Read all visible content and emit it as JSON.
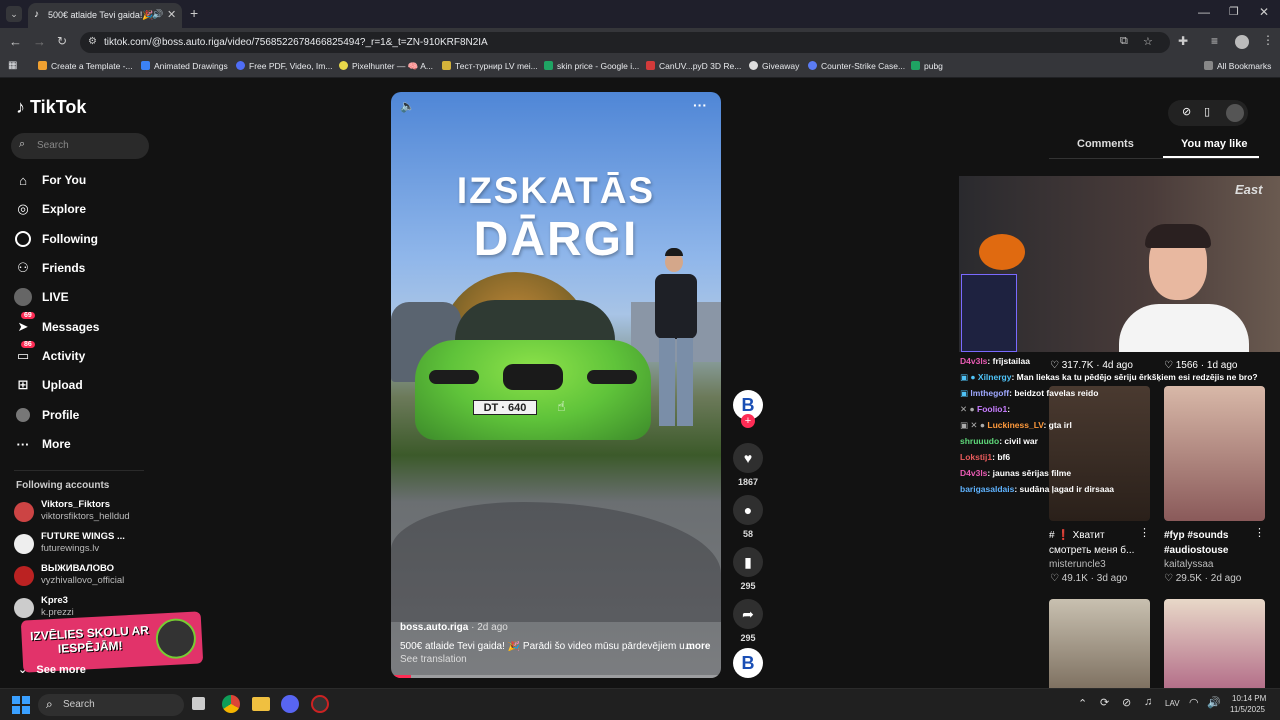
{
  "browser": {
    "tab_title": "500€ atlaide Tevi gaida!🎉",
    "url": "tiktok.com/@boss.auto.riga/video/7568522678466825494?_r=1&_t=ZN-910KRF8N2IA",
    "bookmarks": [
      "Create a Template -...",
      "Animated Drawings",
      "Free PDF, Video, Im...",
      "Pixelhunter — 🧠 A...",
      "Тест-турнир LV mei...",
      "skin price - Google i...",
      "CanUV...pyD 3D Re...",
      "Giveaway",
      "Counter-Strike Case...",
      "pubg"
    ],
    "all_bookmarks": "All Bookmarks"
  },
  "sidebar": {
    "logo": "TikTok",
    "search_placeholder": "Search",
    "nav": [
      {
        "label": "For You",
        "icon": "home-icon"
      },
      {
        "label": "Explore",
        "icon": "compass-icon"
      },
      {
        "label": "Following",
        "icon": "following-icon"
      },
      {
        "label": "Friends",
        "icon": "friends-icon"
      },
      {
        "label": "LIVE",
        "icon": "live-icon"
      },
      {
        "label": "Messages",
        "icon": "messages-icon",
        "badge": "69"
      },
      {
        "label": "Activity",
        "icon": "activity-icon",
        "badge": "86"
      },
      {
        "label": "Upload",
        "icon": "upload-icon"
      },
      {
        "label": "Profile",
        "icon": "profile-icon"
      },
      {
        "label": "More",
        "icon": "more-icon"
      }
    ],
    "following_title": "Following accounts",
    "accounts": [
      {
        "name": "Viktors_Fiktors",
        "handle": "viktorsfiktors_helldud"
      },
      {
        "name": "FUTURE WINGS ...",
        "handle": "futurewings.lv"
      },
      {
        "name": "ВЫЖИВАЛОВО",
        "handle": "vyzhivallovo_official"
      },
      {
        "name": "Kpre3",
        "handle": "k.prezzi"
      }
    ],
    "see_more": "See more",
    "ad_text": "IZVĒLIES SKOLU AR IESPĒJĀM!"
  },
  "video": {
    "title_line1": "IZSKATĀS",
    "title_line2": "DĀRGI",
    "plate": "DT · 640",
    "author": "boss.auto.riga",
    "date": "· 2d ago",
    "caption": "500€ atlaide Tevi gaida! 🎉   Parādi šo video mūsu pārdevējiem u...",
    "more": "more",
    "see_translation": "See translation"
  },
  "actions": {
    "likes": "1867",
    "comments": "58",
    "saves": "295",
    "shares": "295"
  },
  "rightpanel": {
    "tab_comments": "Comments",
    "tab_you_may_like": "You may like",
    "row1_left": {
      "likes": "317.7K",
      "date": "4d ago"
    },
    "row1_right": {
      "likes": "1566",
      "date": "1d ago"
    },
    "row2_left": {
      "title": "# ❗ Хватит смотреть меня б...",
      "author": "misteruncle3",
      "likes": "49.1K",
      "date": "3d ago"
    },
    "row2_right": {
      "title": "#fyp #sounds #audiostouse",
      "author": "kaitalyssaa",
      "likes": "29.5K",
      "date": "2d ago"
    }
  },
  "chat": [
    {
      "user": "D4v3ls",
      "msg": ": frījstailaa",
      "color": "#e85bb3"
    },
    {
      "user": "Xilnergy",
      "msg": ": Man liekas ka tu pēdējo sēriju ērkšķiem esi redzējis ne bro?",
      "color": "#4fc3f7"
    },
    {
      "user": "lmthegoff",
      "msg": ": beidzot favelas reido",
      "color": "#9fa8ff"
    },
    {
      "user": "Foolio1",
      "msg": ":",
      "color": "#c77dff"
    },
    {
      "user": "Luckiness_LV",
      "msg": ": gta irl",
      "color": "#ff9a3c"
    },
    {
      "user": "shruuudo",
      "msg": ": civil war",
      "color": "#5fd97a"
    },
    {
      "user": "Lokstij1",
      "msg": ": bf6",
      "color": "#e85b5b"
    },
    {
      "user": "D4v3ls",
      "msg": ": jaunas sērijas filme",
      "color": "#e85bb3"
    },
    {
      "user": "barigasaldais",
      "msg": ": sudāna ļagad ir dirsaaa",
      "color": "#5fb3ff"
    }
  ],
  "taskbar": {
    "search": "Search",
    "lang": "LAV",
    "time": "10:14 PM",
    "date": "11/5/2025"
  }
}
